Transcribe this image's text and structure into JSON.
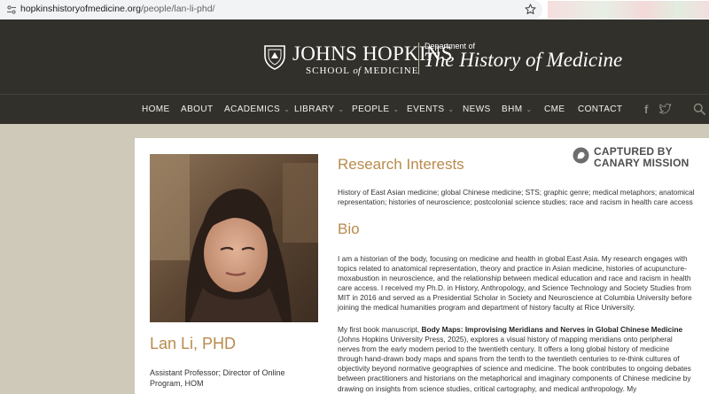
{
  "browser": {
    "url_host": "hopkinshistoryofmedicine.org",
    "url_path": "/people/lan-li-phd/"
  },
  "header": {
    "brand_name": "JOHNS HOPKINS",
    "brand_school_pre": "SCHOOL ",
    "brand_school_of": "of",
    "brand_school_post": " MEDICINE",
    "dept_of": "Department of",
    "dept_title": "The History of Medicine"
  },
  "nav": {
    "items": [
      {
        "label": "HOME"
      },
      {
        "label": "ABOUT"
      },
      {
        "label": "ACADEMICS"
      },
      {
        "label": "LIBRARY"
      },
      {
        "label": "PEOPLE"
      },
      {
        "label": "EVENTS"
      },
      {
        "label": "NEWS"
      },
      {
        "label": "BHM"
      },
      {
        "label": "CME"
      },
      {
        "label": "CONTACT"
      }
    ],
    "facebook_glyph": "f"
  },
  "badge": {
    "line1": "CAPTURED BY",
    "line2": "CANARY MISSION"
  },
  "profile": {
    "name": "Lan Li, PHD",
    "title": "Assistant Professor; Director of Online Program, HOM"
  },
  "sections": {
    "research_heading": "Research Interests",
    "research_text": "History of East Asian medicine; global Chinese medicine; STS; graphic genre; medical metaphors; anatomical representation; histories of neuroscience; postcolonial science studies; race and racism in health care access",
    "bio_heading": "Bio",
    "bio_p1": "I am a historian of the body, focusing on medicine and health in global East Asia. My research engages with topics related to anatomical representation, theory and practice in Asian medicine, histories of acupuncture-moxabustion in neuroscience, and the relationship between medical education and race and racism in health care access. I received my Ph.D. in History, Anthropology, and Science Technology and Society Studies from MIT in 2016 and served as a Presidential Scholar in Society and Neuroscience at Columbia University before joining the medical humanities program and department of history faculty at Rice University.",
    "bio_p2_pre": "My first book manuscript, ",
    "bio_p2_book": "Body Maps: Improvising Meridians and Nerves in Global Chinese Medicine",
    "bio_p2_post": " (Johns Hopkins University Press, 2025), explores a visual history of mapping meridians onto peripheral nerves from the early modern period to the twentieth century. It offers a long global history of medicine through hand-drawn body maps and spans from the tenth to the twentieth centuries to re-think cultures of objectivity beyond normative geographies of science and medicine. The book contributes to ongoing debates between practitioners and historians on the metaphorical and imaginary components of Chinese medicine by drawing on insights from science studies, critical cartography, and medical anthropology. My"
  },
  "colors": {
    "header_bg": "#31302b",
    "accent_gold": "#b98a4c",
    "page_bg": "#cfc9b9"
  }
}
